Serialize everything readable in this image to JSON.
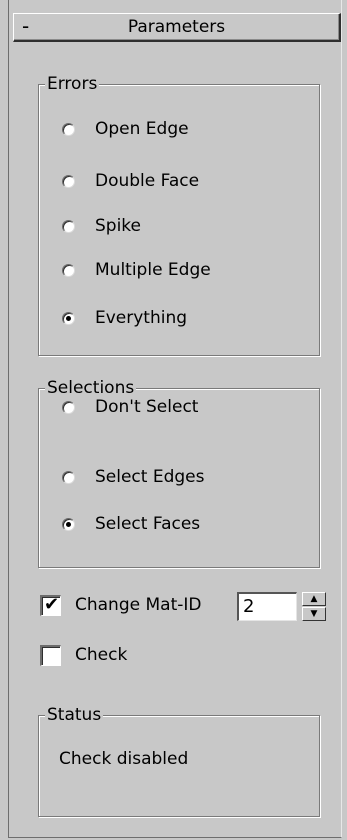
{
  "rollout": {
    "collapse_symbol": "-",
    "title": "Parameters"
  },
  "errors": {
    "label": "Errors",
    "options": [
      {
        "label": "Open Edge",
        "checked": false
      },
      {
        "label": "Double Face",
        "checked": false
      },
      {
        "label": "Spike",
        "checked": false
      },
      {
        "label": "Multiple Edge",
        "checked": false
      },
      {
        "label": "Everything",
        "checked": true
      }
    ]
  },
  "selections": {
    "label": "Selections",
    "options": [
      {
        "label": "Don't Select",
        "checked": false
      },
      {
        "label": "Select Edges",
        "checked": false
      },
      {
        "label": "Select Faces",
        "checked": true
      }
    ]
  },
  "change_mat_id": {
    "label": "Change Mat-ID",
    "checked": true,
    "check_glyph": "✔",
    "value": "2"
  },
  "check": {
    "label": "Check",
    "checked": false
  },
  "status": {
    "label": "Status",
    "text": "Check disabled"
  },
  "icons": {
    "spin_up": "▲",
    "spin_down": "▼"
  }
}
